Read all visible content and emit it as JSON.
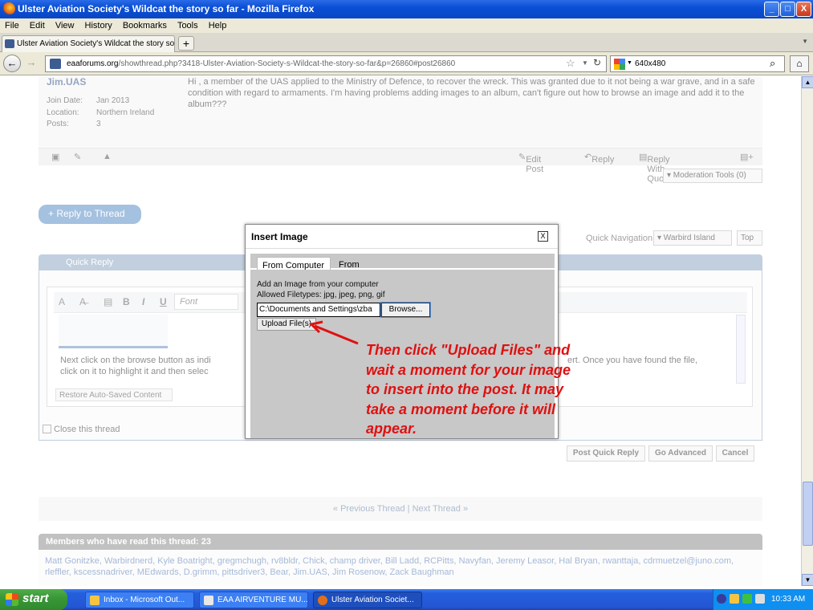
{
  "window": {
    "title": "Ulster Aviation Society's Wildcat the story so far - Mozilla Firefox",
    "min_glyph": "_",
    "max_glyph": "□",
    "close_glyph": "X"
  },
  "menu": [
    "File",
    "Edit",
    "View",
    "History",
    "Bookmarks",
    "Tools",
    "Help"
  ],
  "tab": {
    "label": "Ulster Aviation Society's Wildcat the story so...",
    "new_tab_glyph": "+"
  },
  "nav": {
    "url_domain": "eaaforums.org",
    "url_path": "/showthread.php?3418-Ulster-Aviation-Society-s-Wildcat-the-story-so-far&p=26860#post26860",
    "search_value": "640x480",
    "back_glyph": "←",
    "forward_glyph": "→",
    "home_glyph": "⌂"
  },
  "post": {
    "username": "Jim.UAS",
    "join_date_label": "Join Date:",
    "join_date": "Jan 2013",
    "location_label": "Location:",
    "location": "Northern Ireland",
    "posts_label": "Posts:",
    "posts": "3",
    "body": "Hi , a member of the UAS applied to the Ministry of Defence, to recover the wreck. This was granted due to it not being a war grave, and in a safe condition with regard to armaments. I'm having problems adding images to an album, can't figure out how to browse an image and add it to the album???",
    "edit_post": "Edit Post",
    "reply": "Reply",
    "reply_with_quote": "Reply With Quote",
    "moderation_tools": "▾ Moderation Tools (0)"
  },
  "thread": {
    "reply_to_thread": "+ Reply to Thread",
    "quick_navigation": "Quick Navigation",
    "forum_select": "▾ Warbird Island",
    "top": "Top",
    "quick_reply": "Quick Reply",
    "font_placeholder": "Font",
    "editor_text": "Next click on the browse button as indi",
    "editor_text_2": "click on it to highlight it and then selec",
    "editor_text_right": "ert.  Once you have found the file,",
    "restore_auto_saved": "Restore Auto-Saved Content",
    "close_thread": "Close this thread",
    "post_quick_reply": "Post Quick Reply",
    "go_advanced": "Go Advanced",
    "cancel": "Cancel",
    "previous_thread": "« Previous Thread",
    "next_thread": "Next Thread »",
    "separator": "|",
    "members_header": "Members who have read this thread: 23",
    "members_list": "Matt Gonitzke, Warbirdnerd, Kyle Boatright, gregmchugh, rv8bldr, Chick, champ driver, Bill Ladd, RCPitts, Navyfan, Jeremy Leasor, Hal Bryan, rwanttaja, cdrmuetzel@juno.com, rleffler, kscessnadriver, MEdwards, D.grimm, pittsdriver3, Bear, Jim.UAS, Jim Rosenow, Zack Baughman"
  },
  "modal": {
    "title": "Insert Image",
    "close_glyph": "X",
    "tab_computer": "From Computer",
    "tab_url": "From URL",
    "add_label": "Add an Image from your computer",
    "allowed_types": "Allowed Filetypes: jpg, jpeg, png, gif",
    "file_value": "C:\\Documents and Settings\\zba",
    "browse": "Browse...",
    "upload": "Upload File(s)"
  },
  "annotation": {
    "text": "Then click \"Upload Files\" and wait a moment for your image to insert into the post.  It may take a moment before it will appear.",
    "color": "#e01010"
  },
  "taskbar": {
    "start": "start",
    "tasks": [
      "Inbox - Microsoft Out...",
      "EAA AIRVENTURE MU...",
      "Ulster Aviation Societ..."
    ],
    "clock": "10:33 AM"
  }
}
